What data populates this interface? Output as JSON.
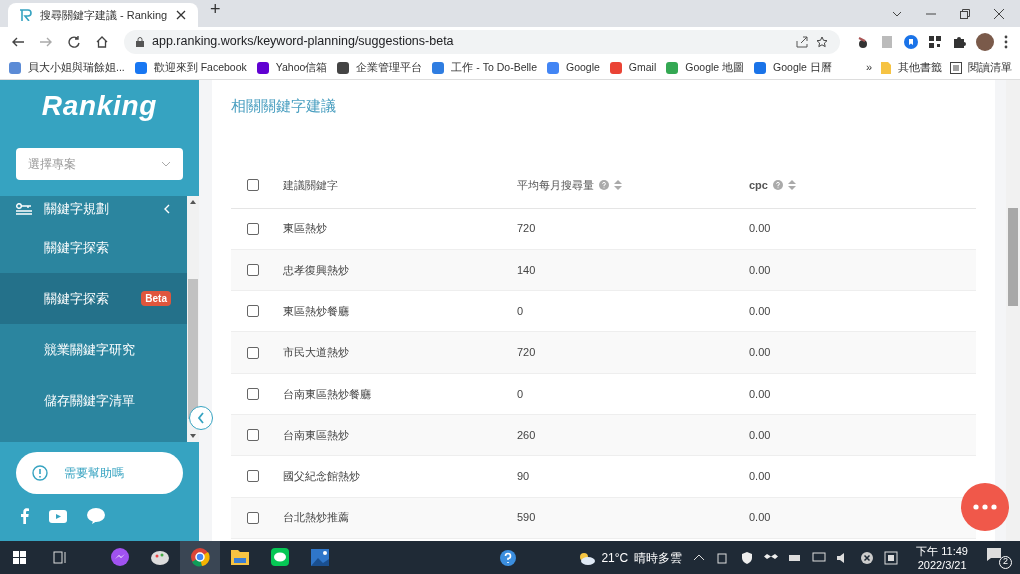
{
  "browser": {
    "tab": {
      "title": "搜尋關鍵字建議 - Ranking"
    },
    "new_tab": "+",
    "address": "app.ranking.works/keyword-planning/suggestions-beta",
    "bookmarks": [
      {
        "label": "貝大小姐與瑞餘姐...",
        "color": "#5b8bd6"
      },
      {
        "label": "歡迎來到 Facebook",
        "color": "#1877f2"
      },
      {
        "label": "Yahoo信箱",
        "color": "#6001d2"
      },
      {
        "label": "企業管理平台",
        "color": "#444444"
      },
      {
        "label": "工作 - To Do-Belle",
        "color": "#2f7de1"
      },
      {
        "label": "Google",
        "color": "#4285f4"
      },
      {
        "label": "Gmail",
        "color": "#ea4335"
      },
      {
        "label": "Google 地圖",
        "color": "#34a853"
      },
      {
        "label": "Google 日曆",
        "color": "#1a73e8"
      }
    ],
    "more": "»",
    "other_bookmarks": "其他書籤",
    "reading_list": "閱讀清單"
  },
  "sidebar": {
    "logo": "Ranking",
    "project_select": {
      "placeholder": "選擇專案"
    },
    "menu": {
      "label": "關鍵字規劃",
      "expanded": true,
      "children": [
        {
          "label": "關鍵字探索",
          "selected": false
        },
        {
          "label": "關鍵字探索",
          "badge": "Beta",
          "selected": true
        },
        {
          "label": "競業關鍵字研究",
          "selected": false
        },
        {
          "label": "儲存關鍵字清單",
          "selected": false
        }
      ]
    },
    "help": "需要幫助嗎"
  },
  "main": {
    "title": "相關關鍵字建議",
    "table": {
      "select_all_checked": false,
      "columns": [
        "建議關鍵字",
        "平均每月搜尋量",
        "cpc"
      ],
      "rows": [
        {
          "checked": false,
          "cells": [
            "東區熱炒",
            "720",
            "0.00"
          ]
        },
        {
          "checked": false,
          "cells": [
            "忠孝復興熱炒",
            "140",
            "0.00"
          ]
        },
        {
          "checked": false,
          "cells": [
            "東區熱炒餐廳",
            "0",
            "0.00"
          ]
        },
        {
          "checked": false,
          "cells": [
            "市民大道熱炒",
            "720",
            "0.00"
          ]
        },
        {
          "checked": false,
          "cells": [
            "台南東區熱炒餐廳",
            "0",
            "0.00"
          ]
        },
        {
          "checked": false,
          "cells": [
            "台南東區熱炒",
            "260",
            "0.00"
          ]
        },
        {
          "checked": false,
          "cells": [
            "國父紀念館熱炒",
            "90",
            "0.00"
          ]
        },
        {
          "checked": false,
          "cells": [
            "台北熱炒推薦",
            "590",
            "0.00"
          ]
        }
      ]
    }
  },
  "taskbar": {
    "weather": "21°C",
    "weather_text": "晴時多雲",
    "time": "下午 11:49",
    "date": "2022/3/21",
    "notifications": "2"
  }
}
